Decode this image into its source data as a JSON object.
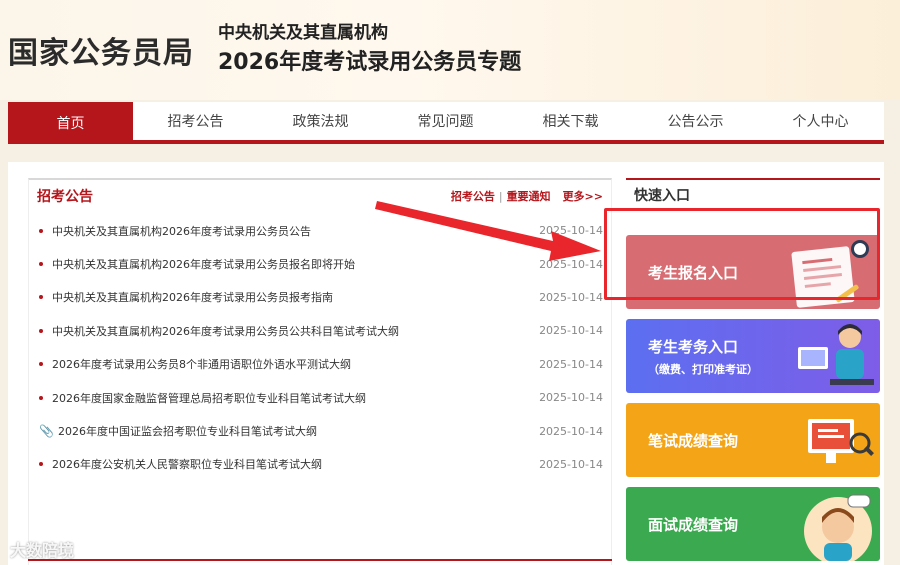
{
  "header": {
    "site_name": "国家公务员局",
    "sub_title": "中央机关及其直属机构",
    "main_title": "2026年度考试录用公务员专题"
  },
  "nav": [
    "首页",
    "招考公告",
    "政策法规",
    "常见问题",
    "相关下载",
    "公告公示",
    "个人中心"
  ],
  "announcements": {
    "title": "招考公告",
    "links": [
      "招考公告",
      "重要通知"
    ],
    "more": "更多>>",
    "items": [
      {
        "title": "中央机关及其直属机构2026年度考试录用公务员公告",
        "date": "2025-10-14",
        "attachment": false
      },
      {
        "title": "中央机关及其直属机构2026年度考试录用公务员报名即将开始",
        "date": "2025-10-14",
        "attachment": false
      },
      {
        "title": "中央机关及其直属机构2026年度考试录用公务员报考指南",
        "date": "2025-10-14",
        "attachment": false
      },
      {
        "title": "中央机关及其直属机构2026年度考试录用公务员公共科目笔试考试大纲",
        "date": "2025-10-14",
        "attachment": false
      },
      {
        "title": "2026年度考试录用公务员8个非通用语职位外语水平测试大纲",
        "date": "2025-10-14",
        "attachment": false
      },
      {
        "title": "2026年度国家金融监督管理总局招考职位专业科目笔试考试大纲",
        "date": "2025-10-14",
        "attachment": false
      },
      {
        "title": "2026年度中国证监会招考职位专业科目笔试考试大纲",
        "date": "2025-10-14",
        "attachment": true
      },
      {
        "title": "2026年度公安机关人民警察职位专业科目笔试考试大纲",
        "date": "2025-10-14",
        "attachment": false
      }
    ]
  },
  "quick": {
    "title": "快速入口",
    "tiles": [
      {
        "label": "考生报名入口",
        "sub": ""
      },
      {
        "label": "考生考务入口",
        "sub": "（缴费、打印准考证）"
      },
      {
        "label": "笔试成绩查询",
        "sub": ""
      },
      {
        "label": "面试成绩查询",
        "sub": ""
      }
    ]
  },
  "watermark": "大数陪境",
  "colors": {
    "accent": "#b5161c",
    "highlight": "#e8262b"
  }
}
